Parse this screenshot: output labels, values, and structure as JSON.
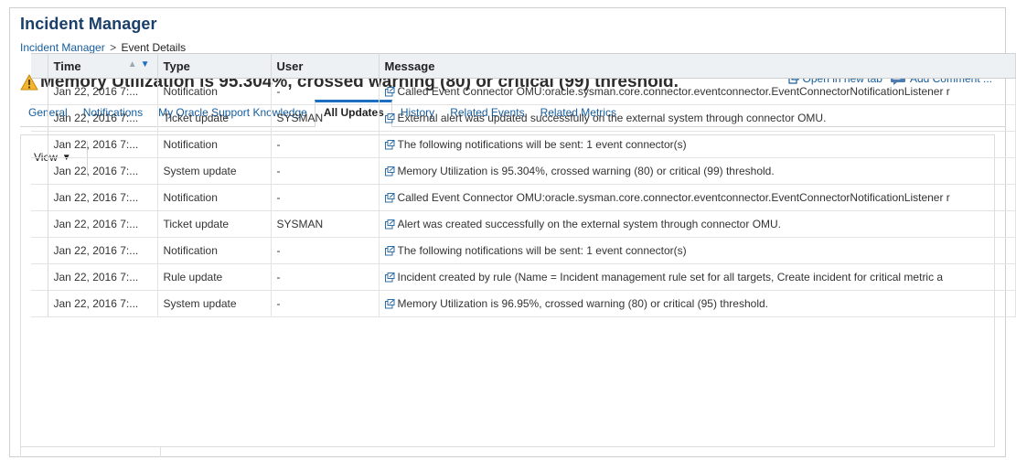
{
  "app": {
    "title": "Incident Manager"
  },
  "breadcrumb": {
    "root": "Incident Manager",
    "separator": ">",
    "current": "Event Details"
  },
  "event": {
    "title": "Memory Utilization is 95.304%, crossed warning (80) or critical (99) threshold.",
    "severity_icon": "warning-triangle-icon",
    "severity_color": "#f2b62b"
  },
  "actions": {
    "open_new_tab": "Open in new tab",
    "add_comment": "Add Comment ..."
  },
  "tabs": [
    {
      "label": "General",
      "active": false
    },
    {
      "label": "Notifications",
      "active": false
    },
    {
      "label": "My Oracle Support Knowledge",
      "active": false
    },
    {
      "label": "All Updates",
      "active": true
    },
    {
      "label": "History",
      "active": false
    },
    {
      "label": "Related Events",
      "active": false
    },
    {
      "label": "Related Metrics",
      "active": false
    }
  ],
  "toolbar": {
    "view_label": "View"
  },
  "table": {
    "columns": {
      "time": "Time",
      "type": "Type",
      "user": "User",
      "message": "Message"
    },
    "rows": [
      {
        "time": "Jan 22, 2016 7:...",
        "type": "Notification",
        "user": "-",
        "message": "Called Event Connector OMU:oracle.sysman.core.connector.eventconnector.EventConnectorNotificationListener r"
      },
      {
        "time": "Jan 22, 2016 7:...",
        "type": "Ticket update",
        "user": "SYSMAN",
        "message": "External alert was updated successfully on the external system through connector OMU."
      },
      {
        "time": "Jan 22, 2016 7:...",
        "type": "Notification",
        "user": "-",
        "message": "The following notifications will be sent: 1 event connector(s)"
      },
      {
        "time": "Jan 22, 2016 7:...",
        "type": "System update",
        "user": "-",
        "message": "Memory Utilization is 95.304%, crossed warning (80) or critical (99) threshold."
      },
      {
        "time": "Jan 22, 2016 7:...",
        "type": "Notification",
        "user": "-",
        "message": "Called Event Connector OMU:oracle.sysman.core.connector.eventconnector.EventConnectorNotificationListener r"
      },
      {
        "time": "Jan 22, 2016 7:...",
        "type": "Ticket update",
        "user": "SYSMAN",
        "message": "Alert was created successfully on the external system through connector OMU."
      },
      {
        "time": "Jan 22, 2016 7:...",
        "type": "Notification",
        "user": "-",
        "message": "The following notifications will be sent: 1 event connector(s)"
      },
      {
        "time": "Jan 22, 2016 7:...",
        "type": "Rule update",
        "user": "-",
        "message": "Incident created by rule (Name = Incident management rule set for all targets, Create incident for critical metric a"
      },
      {
        "time": "Jan 22, 2016 7:...",
        "type": "System update",
        "user": "-",
        "message": "Memory Utilization is 96.95%, crossed warning (80) or critical (95) threshold."
      }
    ]
  },
  "colors": {
    "accent": "#1b6ec2",
    "link": "#145c9e",
    "title": "#1a3f6b",
    "header_bg": "#eef1f4"
  }
}
